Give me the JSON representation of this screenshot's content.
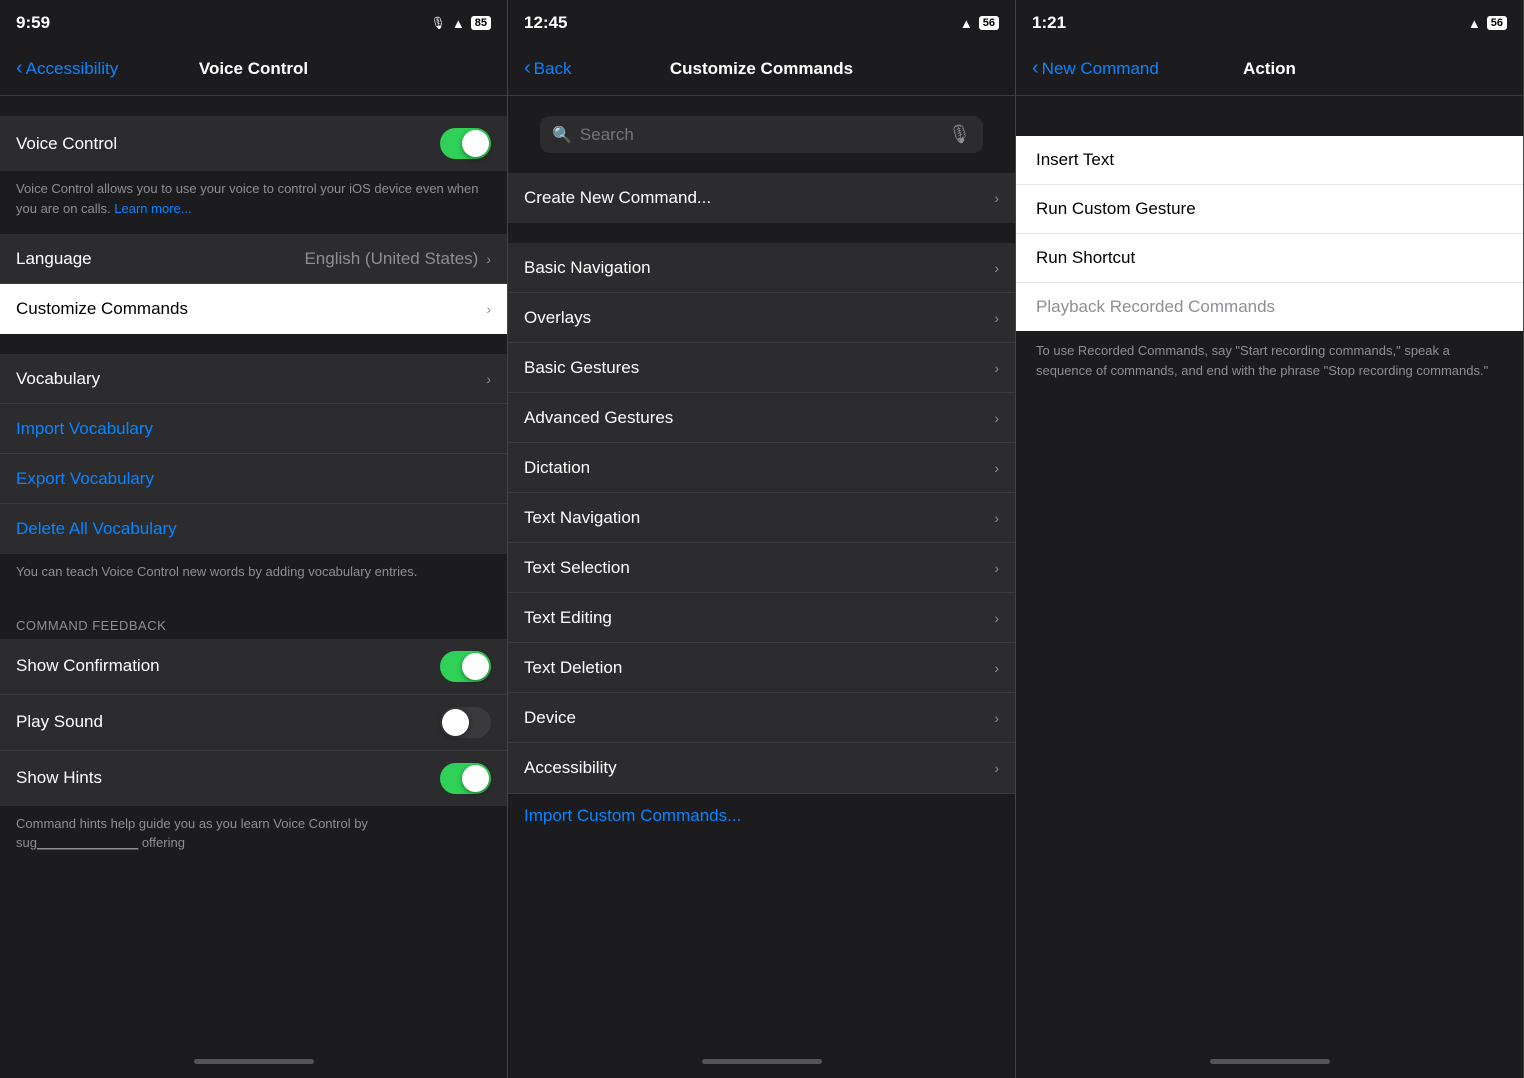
{
  "screen1": {
    "statusBar": {
      "time": "9:59",
      "micIcon": "🎙",
      "wifiIcon": "wifi",
      "battery": "85"
    },
    "navBack": "Accessibility",
    "navTitle": "Voice Control",
    "rows": [
      {
        "label": "Voice Control",
        "type": "toggle",
        "state": "on"
      },
      {
        "description": "Voice Control allows you to use your voice to control your iOS device even when you are on calls. ",
        "link": "Learn more..."
      }
    ],
    "languageRow": {
      "label": "Language",
      "value": "English (United States)"
    },
    "customizeRow": {
      "label": "Customize Commands"
    },
    "vocabSection": {
      "rows": [
        {
          "label": "Vocabulary"
        },
        {
          "label": "Import Vocabulary",
          "color": "blue"
        },
        {
          "label": "Export Vocabulary",
          "color": "blue"
        },
        {
          "label": "Delete All Vocabulary",
          "color": "blue"
        }
      ],
      "description": "You can teach Voice Control new words by adding vocabulary entries."
    },
    "commandFeedback": {
      "header": "COMMAND FEEDBACK",
      "rows": [
        {
          "label": "Show Confirmation",
          "type": "toggle",
          "state": "on"
        },
        {
          "label": "Play Sound",
          "type": "toggle",
          "state": "off"
        },
        {
          "label": "Show Hints",
          "type": "toggle",
          "state": "on"
        }
      ],
      "description": "Command hints help guide you as you learn Voice Control by sug..."
    }
  },
  "screen2": {
    "statusBar": {
      "time": "12:45",
      "wifiIcon": "wifi",
      "battery": "56"
    },
    "navBack": "Back",
    "navTitle": "Customize Commands",
    "search": {
      "placeholder": "Search",
      "micIcon": "🎙"
    },
    "createNew": {
      "label": "Create New Command...",
      "chevron": "›"
    },
    "rows": [
      {
        "label": "Basic Navigation"
      },
      {
        "label": "Overlays"
      },
      {
        "label": "Basic Gestures"
      },
      {
        "label": "Advanced Gestures"
      },
      {
        "label": "Dictation"
      },
      {
        "label": "Text Navigation"
      },
      {
        "label": "Text Selection"
      },
      {
        "label": "Text Editing"
      },
      {
        "label": "Text Deletion"
      },
      {
        "label": "Device"
      },
      {
        "label": "Accessibility"
      }
    ],
    "importLink": "Import Custom Commands..."
  },
  "screen3": {
    "statusBar": {
      "time": "1:21",
      "wifiIcon": "wifi",
      "battery": "56"
    },
    "navBack": "New Command",
    "navTitle": "Action",
    "actions": [
      {
        "label": "Insert Text",
        "disabled": false
      },
      {
        "label": "Run Custom Gesture",
        "disabled": false
      },
      {
        "label": "Run Shortcut",
        "disabled": false
      },
      {
        "label": "Playback Recorded Commands",
        "disabled": true
      }
    ],
    "description": "To use Recorded Commands, say \"Start recording commands,\" speak a sequence of commands, and end with the phrase \"Stop recording commands.\""
  }
}
